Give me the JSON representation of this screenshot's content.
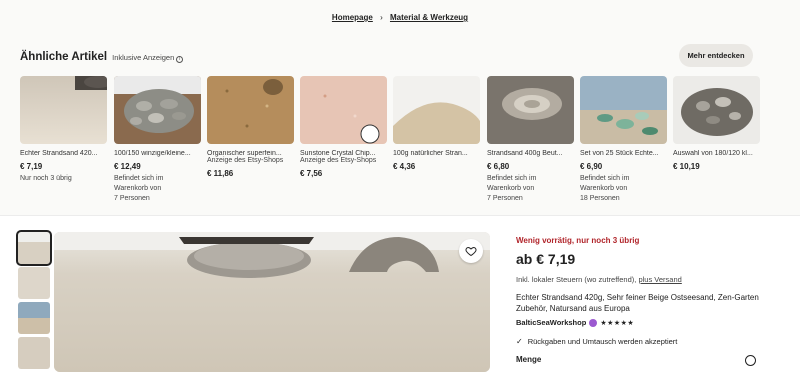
{
  "breadcrumb": {
    "home": "Homepage",
    "separator": "›",
    "category": "Material & Werkzeug"
  },
  "similar": {
    "title": "Ähnliche Artikel",
    "subtitle": "Inklusive Anzeigen",
    "info_icon": "ⓘ",
    "more_button": "Mehr entdecken",
    "items": [
      {
        "title": "Echter Strandsand 420...",
        "price": "€ 7,19",
        "note1": "Nur noch 3 übrig",
        "note2": "",
        "note3": ""
      },
      {
        "title": "100/150 winzige/kleine...",
        "price": "€ 12,49",
        "note1": "Befindet sich im",
        "note2": "Warenkorb von",
        "note3": "7 Personen"
      },
      {
        "title": "Organischer superfein...",
        "sub": "Anzeige des Etsy-Shops",
        "price": "€ 11,86"
      },
      {
        "title": "Sunstone Crystal Chip...",
        "sub": "Anzeige des Etsy-Shops",
        "price": "€ 7,56"
      },
      {
        "title": "100g natürlicher Stran...",
        "price": "€ 4,36"
      },
      {
        "title": "Strandsand 400g Beut...",
        "price": "€ 6,80",
        "note1": "Befindet sich im",
        "note2": "Warenkorb von",
        "note3": "7 Personen"
      },
      {
        "title": "Set von 25 Stück Echte...",
        "price": "€ 6,90",
        "note1": "Befindet sich im",
        "note2": "Warenkorb von",
        "note3": "18 Personen"
      },
      {
        "title": "Auswahl von 180/120 kl...",
        "price": "€ 10,19"
      }
    ]
  },
  "listing": {
    "stock": "Wenig vorrätig, nur noch 3 übrig",
    "price": "ab € 7,19",
    "tax_text": "Inkl. lokaler Steuern (wo zutreffend),",
    "shipping_link": "plus Versand",
    "title": "Echter Strandsand 420g, Sehr feiner Beige Ostseesand, Zen-Garten Zubehör, Natursand aus Europa",
    "shop": "BalticSeaWorkshop",
    "stars": "★★★★★",
    "returns": "Rückgaben und Umtausch werden akzeptiert",
    "quantity_label": "Menge"
  }
}
